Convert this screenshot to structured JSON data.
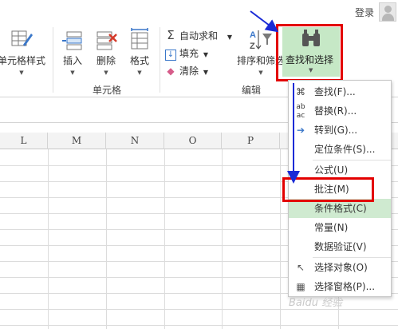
{
  "titlebar": {
    "login": "登录"
  },
  "ribbon": {
    "cell_styles": "单元格样式",
    "insert": "插入",
    "delete": "删除",
    "format": "格式",
    "group_cells": "单元格",
    "autosum": "自动求和",
    "fill": "填充",
    "clear": "清除",
    "sort_filter": "排序和筛选",
    "find_select": "查找和选择",
    "group_edit": "编辑"
  },
  "columns": [
    "L",
    "M",
    "N",
    "O",
    "P"
  ],
  "menu": {
    "items": [
      {
        "label": "查找(F)...",
        "icon": "binoculars-icon"
      },
      {
        "label": "替换(R)...",
        "icon": "replace-icon"
      },
      {
        "label": "转到(G)...",
        "icon": "goto-arrow-icon"
      },
      {
        "label": "定位条件(S)...",
        "icon": ""
      },
      {
        "label": "公式(U)",
        "icon": ""
      },
      {
        "label": "批注(M)",
        "icon": ""
      },
      {
        "label": "条件格式(C)",
        "icon": ""
      },
      {
        "label": "常量(N)",
        "icon": ""
      },
      {
        "label": "数据验证(V)",
        "icon": ""
      },
      {
        "label": "选择对象(O)",
        "icon": "cursor-icon"
      },
      {
        "label": "选择窗格(P)...",
        "icon": "selection-pane-icon"
      }
    ]
  },
  "watermark": "Baidu 经验",
  "colors": {
    "highlight": "#cfead0",
    "annotation_red": "#e30000",
    "arrow_blue": "#1a2bd6"
  }
}
